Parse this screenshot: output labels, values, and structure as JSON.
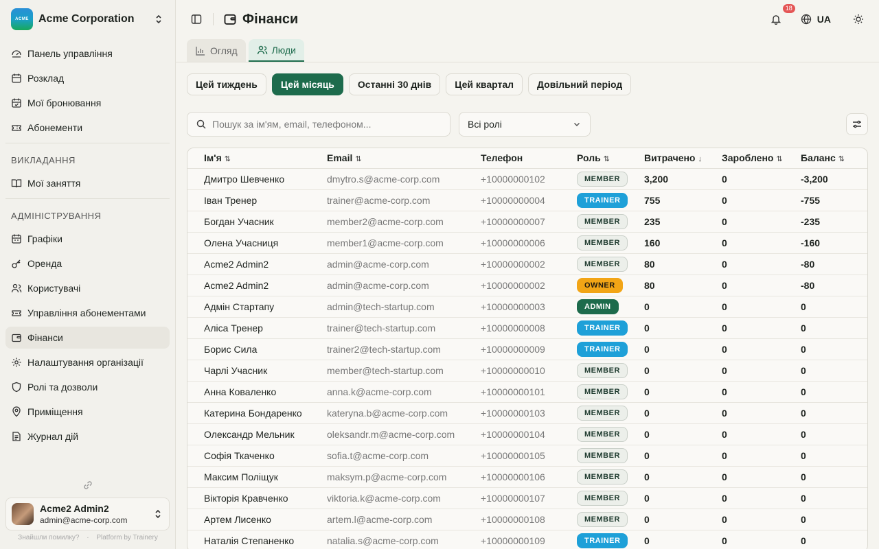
{
  "org": {
    "logo_text": "ACME",
    "name": "Acme Corporation"
  },
  "nav": {
    "main": [
      {
        "label": "Панель управління",
        "icon": "dashboard-icon"
      },
      {
        "label": "Розклад",
        "icon": "calendar-icon"
      },
      {
        "label": "Мої бронювання",
        "icon": "bookings-icon"
      },
      {
        "label": "Абонементи",
        "icon": "tickets-icon"
      }
    ],
    "teaching_section": "ВИКЛАДАННЯ",
    "teaching": [
      {
        "label": "Мої заняття",
        "icon": "book-icon"
      }
    ],
    "admin_section": "АДМІНІСТРУВАННЯ",
    "admin": [
      {
        "label": "Графіки",
        "icon": "schedules-icon"
      },
      {
        "label": "Оренда",
        "icon": "key-icon"
      },
      {
        "label": "Користувачі",
        "icon": "users-icon"
      },
      {
        "label": "Управління абонементами",
        "icon": "memberships-icon"
      },
      {
        "label": "Фінанси",
        "icon": "wallet-icon",
        "active": true
      },
      {
        "label": "Налаштування організації",
        "icon": "gear-icon"
      },
      {
        "label": "Ролі та дозволи",
        "icon": "shield-icon"
      },
      {
        "label": "Приміщення",
        "icon": "location-icon"
      },
      {
        "label": "Журнал дій",
        "icon": "log-icon"
      }
    ]
  },
  "user": {
    "name": "Acme2 Admin2",
    "email": "admin@acme-corp.com"
  },
  "footer": {
    "bug_link": "Знайшли помилку?",
    "separator": "·",
    "platform": "Platform by Trainery"
  },
  "header": {
    "title": "Фінанси",
    "notifications": "18",
    "language": "UA"
  },
  "tabs": [
    {
      "label": "Огляд"
    },
    {
      "label": "Люди",
      "active": true
    }
  ],
  "periods": [
    {
      "label": "Цей тиждень"
    },
    {
      "label": "Цей місяць",
      "active": true
    },
    {
      "label": "Останні 30 днів"
    },
    {
      "label": "Цей квартал"
    },
    {
      "label": "Довільний період"
    }
  ],
  "search": {
    "placeholder": "Пошук за ім'ям, email, телефоном..."
  },
  "role_filter": {
    "value": "Всі ролі"
  },
  "table": {
    "columns": {
      "name": "Ім'я",
      "email": "Email",
      "phone": "Телефон",
      "role": "Роль",
      "spent": "Витрачено",
      "earned": "Зароблено",
      "balance": "Баланс"
    },
    "rows": [
      {
        "name": "Дмитро Шевченко",
        "email": "dmytro.s@acme-corp.com",
        "phone": "+10000000102",
        "role": "MEMBER",
        "spent": "3,200",
        "earned": "0",
        "balance": "-3,200"
      },
      {
        "name": "Іван Тренер",
        "email": "trainer@acme-corp.com",
        "phone": "+10000000004",
        "role": "TRAINER",
        "spent": "755",
        "earned": "0",
        "balance": "-755"
      },
      {
        "name": "Богдан Учасник",
        "email": "member2@acme-corp.com",
        "phone": "+10000000007",
        "role": "MEMBER",
        "spent": "235",
        "earned": "0",
        "balance": "-235"
      },
      {
        "name": "Олена Учасниця",
        "email": "member1@acme-corp.com",
        "phone": "+10000000006",
        "role": "MEMBER",
        "spent": "160",
        "earned": "0",
        "balance": "-160"
      },
      {
        "name": "Acme2 Admin2",
        "email": "admin@acme-corp.com",
        "phone": "+10000000002",
        "role": "MEMBER",
        "spent": "80",
        "earned": "0",
        "balance": "-80"
      },
      {
        "name": "Acme2 Admin2",
        "email": "admin@acme-corp.com",
        "phone": "+10000000002",
        "role": "OWNER",
        "spent": "80",
        "earned": "0",
        "balance": "-80"
      },
      {
        "name": "Адмін Стартапу",
        "email": "admin@tech-startup.com",
        "phone": "+10000000003",
        "role": "ADMIN",
        "spent": "0",
        "earned": "0",
        "balance": "0"
      },
      {
        "name": "Аліса Тренер",
        "email": "trainer@tech-startup.com",
        "phone": "+10000000008",
        "role": "TRAINER",
        "spent": "0",
        "earned": "0",
        "balance": "0"
      },
      {
        "name": "Борис Сила",
        "email": "trainer2@tech-startup.com",
        "phone": "+10000000009",
        "role": "TRAINER",
        "spent": "0",
        "earned": "0",
        "balance": "0"
      },
      {
        "name": "Чарлі Учасник",
        "email": "member@tech-startup.com",
        "phone": "+10000000010",
        "role": "MEMBER",
        "spent": "0",
        "earned": "0",
        "balance": "0"
      },
      {
        "name": "Анна Коваленко",
        "email": "anna.k@acme-corp.com",
        "phone": "+10000000101",
        "role": "MEMBER",
        "spent": "0",
        "earned": "0",
        "balance": "0"
      },
      {
        "name": "Катерина Бондаренко",
        "email": "kateryna.b@acme-corp.com",
        "phone": "+10000000103",
        "role": "MEMBER",
        "spent": "0",
        "earned": "0",
        "balance": "0"
      },
      {
        "name": "Олександр Мельник",
        "email": "oleksandr.m@acme-corp.com",
        "phone": "+10000000104",
        "role": "MEMBER",
        "spent": "0",
        "earned": "0",
        "balance": "0"
      },
      {
        "name": "Софія Ткаченко",
        "email": "sofia.t@acme-corp.com",
        "phone": "+10000000105",
        "role": "MEMBER",
        "spent": "0",
        "earned": "0",
        "balance": "0"
      },
      {
        "name": "Максим Поліщук",
        "email": "maksym.p@acme-corp.com",
        "phone": "+10000000106",
        "role": "MEMBER",
        "spent": "0",
        "earned": "0",
        "balance": "0"
      },
      {
        "name": "Вікторія Кравченко",
        "email": "viktoria.k@acme-corp.com",
        "phone": "+10000000107",
        "role": "MEMBER",
        "spent": "0",
        "earned": "0",
        "balance": "0"
      },
      {
        "name": "Артем Лисенко",
        "email": "artem.l@acme-corp.com",
        "phone": "+10000000108",
        "role": "MEMBER",
        "spent": "0",
        "earned": "0",
        "balance": "0"
      },
      {
        "name": "Наталія Степаненко",
        "email": "natalia.s@acme-corp.com",
        "phone": "+10000000109",
        "role": "TRAINER",
        "spent": "0",
        "earned": "0",
        "balance": "0"
      }
    ]
  },
  "colors": {
    "accent": "#1d6b4c",
    "trainer": "#1ea0d8",
    "owner": "#f2a516",
    "notification": "#e45555"
  }
}
